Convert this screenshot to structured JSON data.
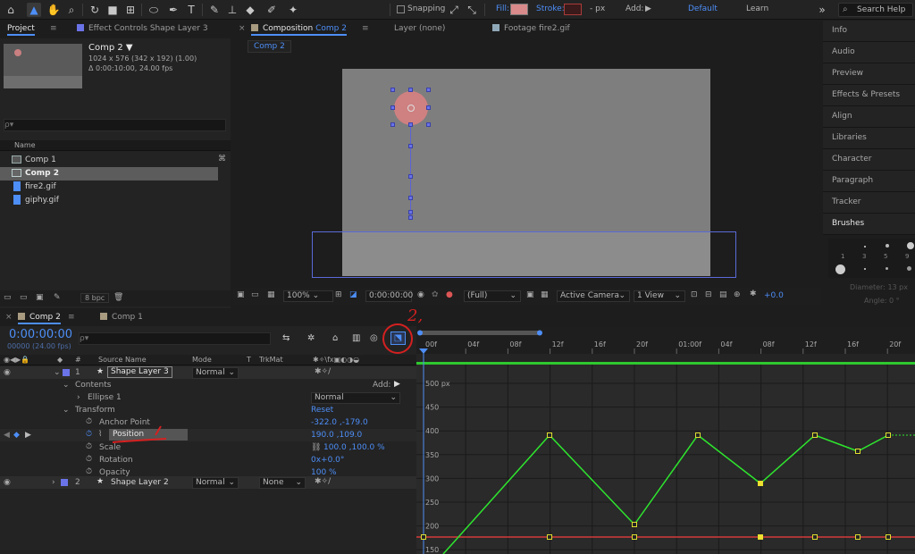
{
  "toolbar": {
    "snapping_label": "Snapping",
    "fill_label": "Fill:",
    "fill_color": "#d98a8a",
    "stroke_label": "Stroke:",
    "stroke_px": "- px",
    "add_label": "Add:",
    "workspace_default": "Default",
    "workspace_learn": "Learn",
    "search_help_placeholder": "Search Help"
  },
  "project_panel": {
    "tab_project": "Project",
    "tab_effect_controls": "Effect Controls Shape Layer 3",
    "comp_name": "Comp 2",
    "comp_info_line1": "1024 x 576  (342 x 192) (1.00)",
    "comp_info_line2": "Δ 0:00:10:00, 24.00 fps",
    "search_placeholder": "ρ▾",
    "column_name": "Name",
    "items": [
      {
        "name": "Comp 1",
        "type": "comp"
      },
      {
        "name": "Comp 2",
        "type": "comp"
      },
      {
        "name": "fire2.gif",
        "type": "file"
      },
      {
        "name": "giphy.gif",
        "type": "file"
      }
    ],
    "bpc_label": "8 bpc"
  },
  "viewer": {
    "tab_composition": "Composition",
    "tab_composition_name": "Comp 2",
    "tab_layer": "Layer  (none)",
    "tab_footage": "Footage  fire2.gif",
    "breadcrumb": "Comp 2",
    "zoom": "100%",
    "timecode": "0:00:00:00",
    "resolution": "(Full)",
    "camera": "Active Camera",
    "views": "1 View",
    "exposure": "+0.0"
  },
  "right_panels": {
    "items": [
      "Info",
      "Audio",
      "Preview",
      "Effects & Presets",
      "Align",
      "Libraries",
      "Character",
      "Paragraph",
      "Tracker",
      "Brushes"
    ],
    "brush_sizes": [
      "1",
      "3",
      "5",
      "9"
    ],
    "diameter": "Diameter: 13 px",
    "angle": "Angle: 0 °"
  },
  "timeline": {
    "tab_comp2": "Comp 2",
    "tab_comp1": "Comp 1",
    "timecode": "0:00:00:00",
    "fps": "00000 (24.00 fps)",
    "search_placeholder": "ρ▾",
    "col_source_name": "Source Name",
    "col_mode": "Mode",
    "col_t": "T",
    "col_trkmat": "TrkMat",
    "col_hash": "#",
    "layers": [
      {
        "num": "1",
        "name": "Shape Layer 3",
        "mode": "Normal"
      },
      {
        "num": "2",
        "name": "Shape Layer 2",
        "mode": "Normal",
        "trkmat": "None"
      }
    ],
    "contents_label": "Contents",
    "add_label": "Add:",
    "ellipse_label": "Ellipse 1",
    "ellipse_mode": "Normal",
    "transform_label": "Transform",
    "reset_label": "Reset",
    "props": [
      {
        "name": "Anchor Point",
        "value": "-322.0 ,-179.0"
      },
      {
        "name": "Position",
        "value": "190.0 ,109.0"
      },
      {
        "name": "Scale",
        "value": "100.0 ,100.0 %"
      },
      {
        "name": "Rotation",
        "value": "0x+0.0°"
      },
      {
        "name": "Opacity",
        "value": "100 %"
      }
    ],
    "annotation": "2,"
  },
  "graph": {
    "ruler_labels": [
      "00f",
      "04f",
      "08f",
      "12f",
      "16f",
      "20f",
      "01:00f",
      "04f",
      "08f",
      "12f",
      "16f",
      "20f"
    ],
    "y_labels": [
      "500 px",
      "450",
      "400",
      "350",
      "300",
      "250",
      "200",
      "150"
    ]
  }
}
